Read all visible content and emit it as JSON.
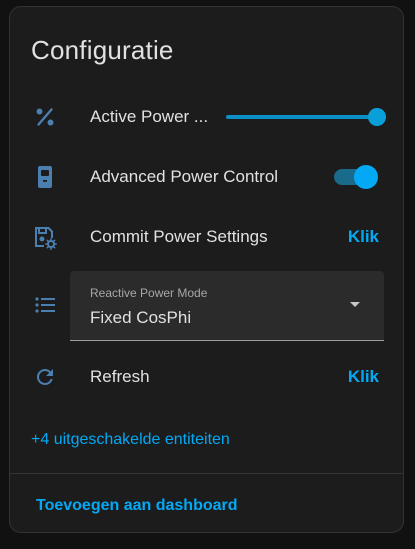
{
  "card": {
    "title": "Configuratie"
  },
  "rows": {
    "active_power": {
      "icon": "percent-icon",
      "label": "Active Power ...",
      "slider_value_fraction": 1.0
    },
    "advanced_power": {
      "icon": "inverter-icon",
      "label": "Advanced Power Control",
      "toggle_on": true
    },
    "commit_power": {
      "icon": "content-save-cog-icon",
      "label": "Commit Power Settings",
      "action": "Klik"
    },
    "reactive_mode": {
      "icon": "format-list-bulleted-icon",
      "field_label": "Reactive Power Mode",
      "value": "Fixed CosPhi"
    },
    "refresh": {
      "icon": "refresh-icon",
      "label": "Refresh",
      "action": "Klik"
    }
  },
  "disabled_entities": "+4 uitgeschakelde entiteiten",
  "footer": {
    "add_to_dashboard": "Toevoegen aan dashboard"
  },
  "colors": {
    "accent": "#03a9f4",
    "icon": "#4a7fb0",
    "card_bg": "#1c1c1c",
    "page_bg": "#111111"
  }
}
